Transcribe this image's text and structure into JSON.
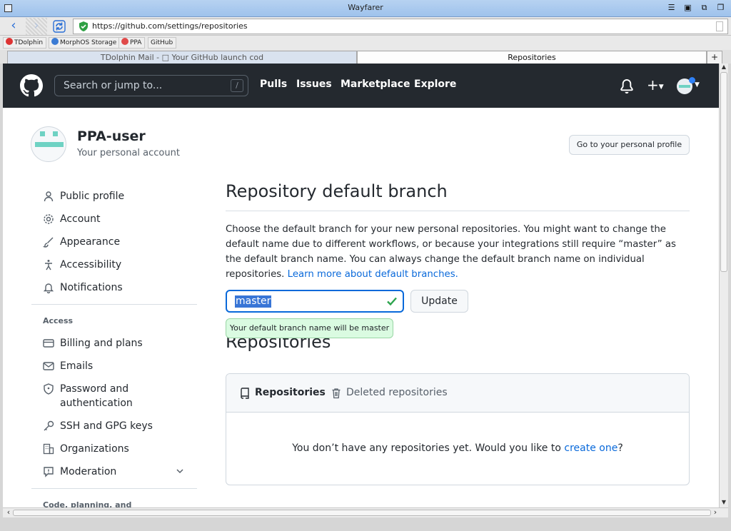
{
  "window": {
    "title": "Wayfarer"
  },
  "browser": {
    "url": "https://github.com/settings/repositories",
    "bookmarks": [
      "TDolphin",
      "MorphOS Storage",
      "PPA",
      "GitHub"
    ],
    "tabs": {
      "inactive": "TDolphin Mail - □ Your GitHub launch cod",
      "active": "Repositories",
      "new": "+"
    }
  },
  "github": {
    "search_placeholder": "Search or jump to...",
    "search_key": "/",
    "nav": [
      "Pulls",
      "Issues",
      "Marketplace",
      "Explore"
    ],
    "plus": "+"
  },
  "account": {
    "name": "PPA-user",
    "subtitle": "Your personal account",
    "profile_button": "Go to your personal profile"
  },
  "sidebar": {
    "items": [
      {
        "label": "Public profile",
        "icon": "person-icon"
      },
      {
        "label": "Account",
        "icon": "gear-icon"
      },
      {
        "label": "Appearance",
        "icon": "paintbrush-icon"
      },
      {
        "label": "Accessibility",
        "icon": "accessibility-icon"
      },
      {
        "label": "Notifications",
        "icon": "bell-icon"
      }
    ],
    "access_heading": "Access",
    "access_items": [
      {
        "label": "Billing and plans",
        "icon": "credit-card-icon"
      },
      {
        "label": "Emails",
        "icon": "mail-icon"
      },
      {
        "label": "Password and",
        "label2": "authentication",
        "icon": "shield-icon"
      },
      {
        "label": "SSH and GPG keys",
        "icon": "key-icon"
      },
      {
        "label": "Organizations",
        "icon": "organization-icon"
      },
      {
        "label": "Moderation",
        "icon": "report-icon"
      }
    ],
    "next_heading": "Code, planning, and"
  },
  "main": {
    "branch_heading": "Repository default branch",
    "description": "Choose the default branch for your new personal repositories. You might want to change the default name due to different workflows, or because your integrations still require “master” as the default branch name. You can always change the default branch name on individual repositories.",
    "learn_more": "Learn more about default branches.",
    "branch_value": "master",
    "update_button": "Update",
    "hint": "Your default branch name will be master",
    "repos_heading": "Repositories",
    "repo_tabs": [
      "Repositories",
      "Deleted repositories"
    ],
    "empty_text": "You don’t have any repositories yet. Would you like to ",
    "empty_link": "create one",
    "empty_end": "?"
  }
}
